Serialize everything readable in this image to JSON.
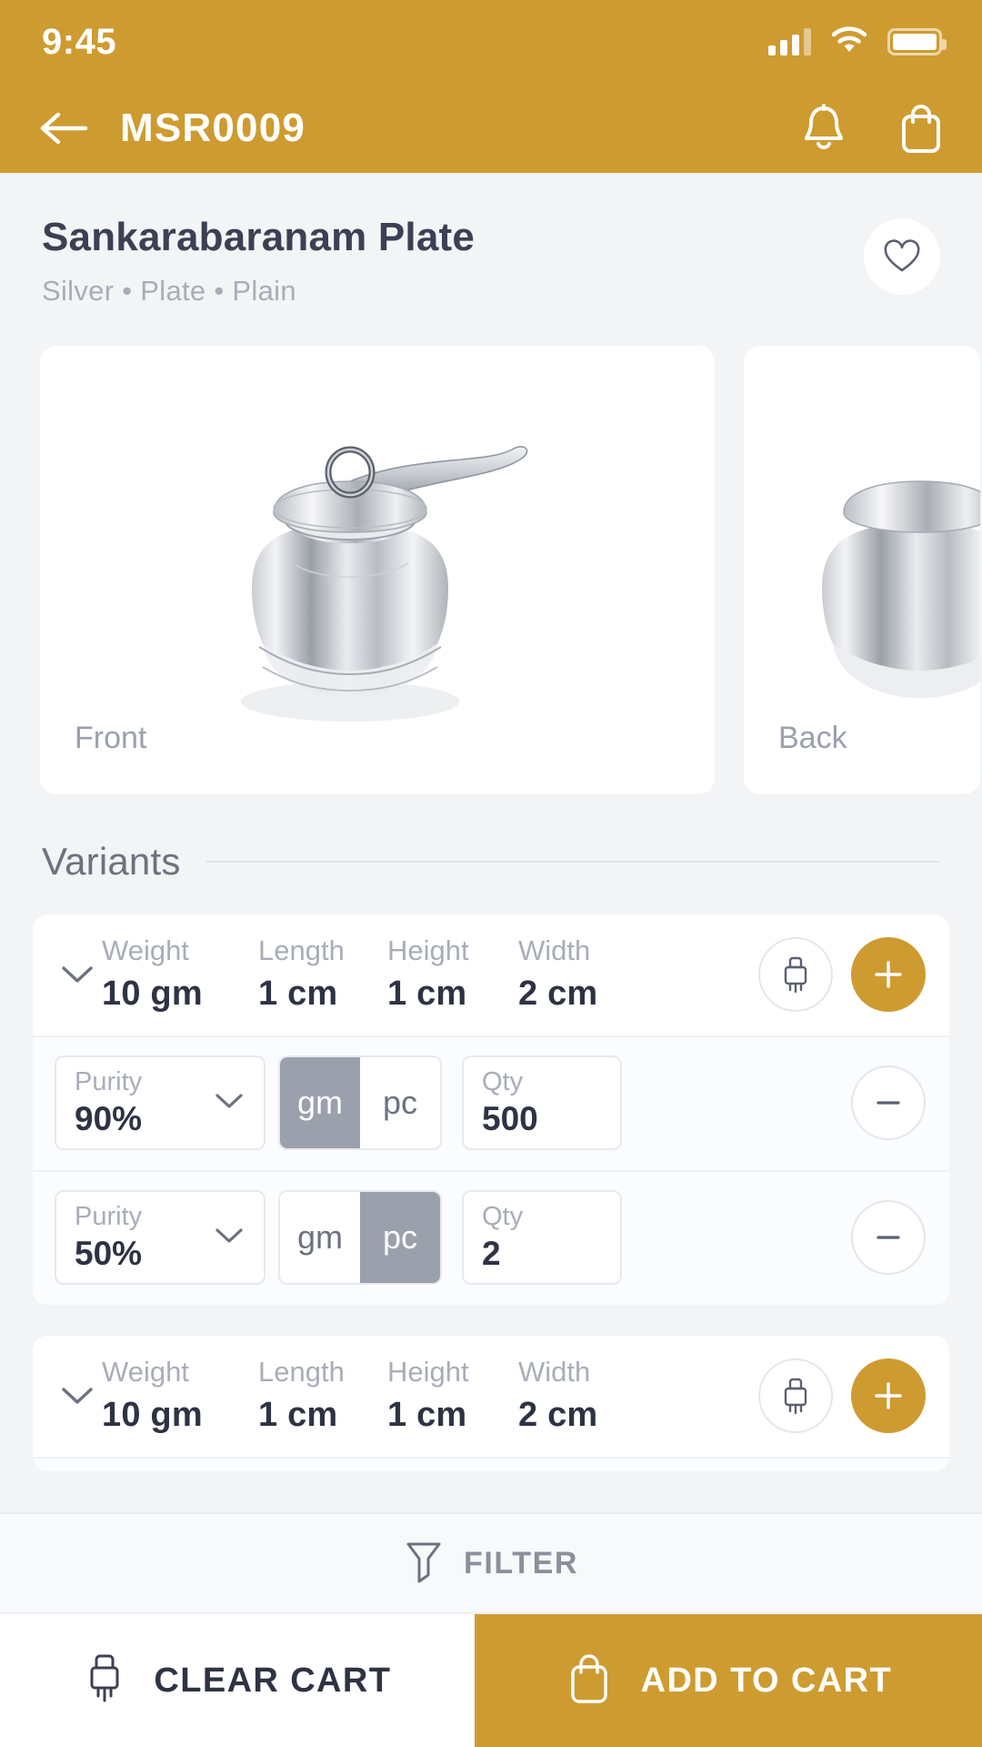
{
  "status_bar": {
    "time": "9:45",
    "signal_icon": "signal-bars-icon",
    "wifi_icon": "wifi-icon",
    "battery_icon": "battery-full-icon"
  },
  "navbar": {
    "back_icon": "arrow-left-icon",
    "title": "MSR0009",
    "notification_icon": "bell-icon",
    "cart_icon": "shopping-bag-icon"
  },
  "product": {
    "title": "Sankarabaranam Plate",
    "subtitle": "Silver • Plate • Plain",
    "favorite_icon": "heart-icon"
  },
  "gallery": [
    {
      "label": "Front"
    },
    {
      "label": "Back"
    }
  ],
  "variants_section": {
    "heading": "Variants",
    "dim_labels": {
      "weight": "Weight",
      "length": "Length",
      "height": "Height",
      "width": "Width"
    },
    "clear_icon": "brush-icon",
    "add_icon": "plus-icon",
    "remove_icon": "minus-icon",
    "chevron_icon": "chevron-down-icon",
    "purity_label": "Purity",
    "qty_label": "Qty",
    "unit_gm": "gm",
    "unit_pc": "pc"
  },
  "variants": [
    {
      "weight": "10 gm",
      "length": "1 cm",
      "height": "1 cm",
      "width": "2 cm",
      "options": [
        {
          "purity": "90%",
          "unit_selected": "gm",
          "qty": "500"
        },
        {
          "purity": "50%",
          "unit_selected": "pc",
          "qty": "2"
        }
      ]
    },
    {
      "weight": "10 gm",
      "length": "1 cm",
      "height": "1 cm",
      "width": "2 cm",
      "options": []
    }
  ],
  "filter": {
    "label": "FILTER",
    "icon": "funnel-icon"
  },
  "bottom_bar": {
    "clear_cart_label": "CLEAR CART",
    "clear_cart_icon": "brush-icon",
    "add_to_cart_label": "ADD TO CART",
    "add_to_cart_icon": "shopping-bag-icon"
  },
  "colors": {
    "accent": "#CE9B30",
    "page_bg": "#F2F4F6",
    "text_dark": "#2E3344",
    "text_muted": "#A8ADB8",
    "toggle_active": "#9AA0AC"
  }
}
